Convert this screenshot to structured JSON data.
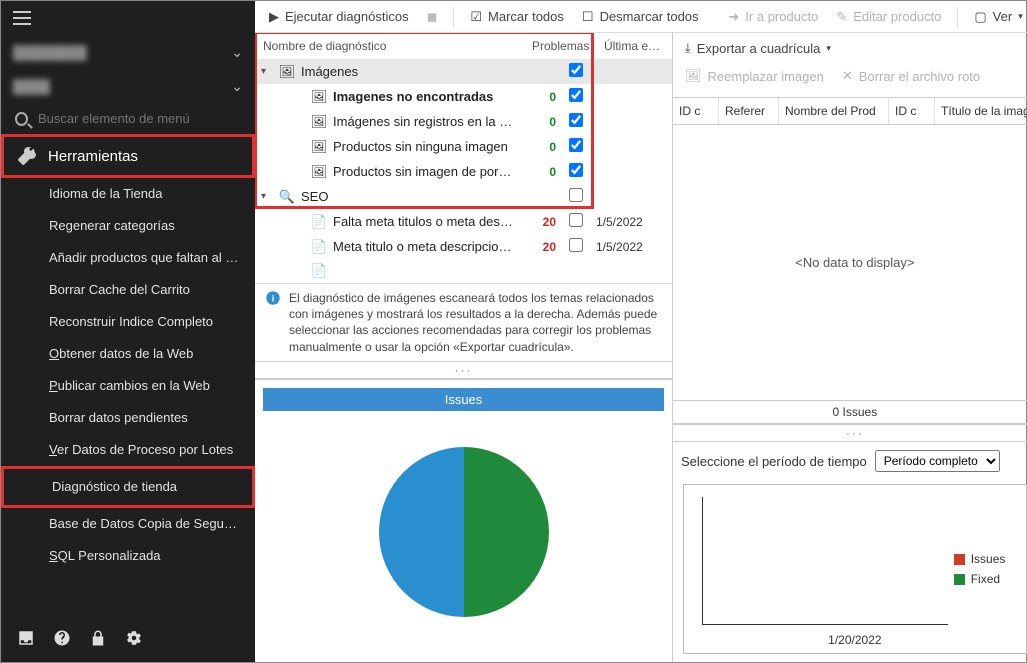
{
  "sidebar": {
    "search_placeholder": "Buscar elemento de menú",
    "header": "Herramientas",
    "items": [
      "Idioma de la Tienda",
      "Regenerar categorías",
      "Añadir productos que faltan al ín…",
      "Borrar Cache del Carrito",
      "Reconstruir Indice Completo",
      "Obtener datos de la Web",
      "Publicar cambios en la Web",
      "Borrar datos pendientes",
      "Ver Datos de Proceso por Lotes",
      "Diagnóstico de tienda",
      "Base de Datos Copia de Seguridad…",
      "SQL Personalizada"
    ]
  },
  "toolbar": {
    "run": "Ejecutar diagnósticos",
    "mark_all": "Marcar todos",
    "unmark_all": "Desmarcar todos",
    "go_product": "Ir a producto",
    "edit_product": "Editar producto",
    "view": "Ver",
    "export_grid": "Exportar a cuadrícula",
    "replace_img": "Reemplazar imagen",
    "delete_broken": "Borrar el archivo roto"
  },
  "diag": {
    "col_name": "Nombre de diagnóstico",
    "col_problems": "Problemas",
    "col_last": "Última e…",
    "group_images": "Imágenes",
    "rows": [
      {
        "label": "Imagenes no encontradas",
        "count": "0"
      },
      {
        "label": "Imágenes sin registros en la base",
        "count": "0"
      },
      {
        "label": "Productos sin ninguna imagen",
        "count": "0"
      },
      {
        "label": "Productos sin imagen de portada",
        "count": "0"
      }
    ],
    "group_seo": "SEO",
    "seo_rows": [
      {
        "label": "Falta meta titulos o meta descripc",
        "count": "20",
        "date": "1/5/2022"
      },
      {
        "label": "Meta titulo o meta descripciones",
        "count": "20",
        "date": "1/5/2022"
      }
    ],
    "info": "El diagnóstico de imágenes escaneará todos los temas relacionados con imágenes y mostrará los resultados a la derecha. Además puede seleccionar las acciones recomendadas para corregir los problemas manualmente o usar la opción «Exportar cuadrícula»."
  },
  "issues": {
    "title": "Issues"
  },
  "grid": {
    "cols": [
      "ID c",
      "Referer",
      "Nombre del Prod",
      "ID c",
      "Título de la imag"
    ],
    "empty": "<No data to display>",
    "footer": "0 Issues"
  },
  "period": {
    "label": "Seleccione el período de tiempo",
    "value": "Período completo"
  },
  "mini": {
    "xlabel": "1/20/2022",
    "legend_issues": "Issues",
    "legend_fixed": "Fixed"
  },
  "chart_data": [
    {
      "type": "pie",
      "title": "Issues",
      "series": [
        {
          "name": "Fixed",
          "value": 50,
          "color": "#1f8a3b"
        },
        {
          "name": "Issues",
          "value": 50,
          "color": "#2a8fcf"
        }
      ]
    },
    {
      "type": "line",
      "title": "",
      "x": [
        "1/20/2022"
      ],
      "series": [
        {
          "name": "Issues",
          "values": [
            0
          ],
          "color": "#d23b2a"
        },
        {
          "name": "Fixed",
          "values": [
            0
          ],
          "color": "#1f8a3b"
        }
      ],
      "xlabel": "",
      "ylabel": ""
    }
  ]
}
